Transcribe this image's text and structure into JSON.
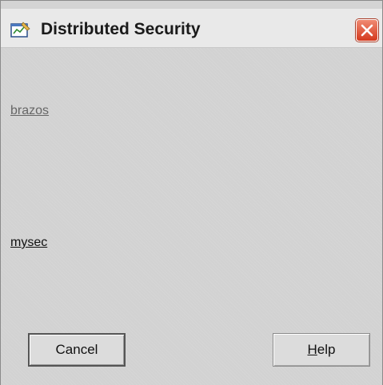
{
  "window": {
    "title": "Distributed Security",
    "app_icon": "app-window-icon",
    "close_icon": "close-icon"
  },
  "links": {
    "brazos": "brazos",
    "mysec": "mysec"
  },
  "buttons": {
    "cancel": "Cancel",
    "help_mnemonic": "H",
    "help_rest": "elp"
  },
  "colors": {
    "window_bg": "#d2d2d2",
    "close_button": "#d4391d",
    "link_dim": "#666666",
    "link_active": "#111111"
  }
}
